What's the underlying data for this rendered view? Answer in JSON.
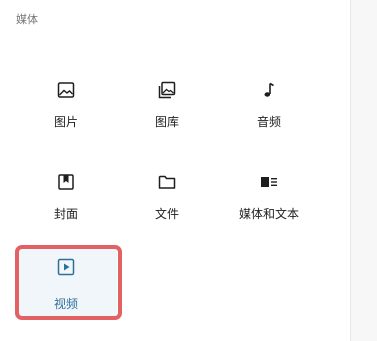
{
  "category": {
    "title": "媒体"
  },
  "blocks": [
    {
      "label": "图片",
      "icon": "image-icon"
    },
    {
      "label": "图库",
      "icon": "gallery-icon"
    },
    {
      "label": "音频",
      "icon": "audio-icon"
    },
    {
      "label": "封面",
      "icon": "cover-icon"
    },
    {
      "label": "文件",
      "icon": "file-icon"
    },
    {
      "label": "媒体和文本",
      "icon": "media-text-icon"
    },
    {
      "label": "视频",
      "icon": "video-icon",
      "selected": true
    }
  ],
  "colors": {
    "highlight": "#e26264",
    "selected_text": "#2f6f99",
    "selected_bg": "#f1f6fb"
  }
}
